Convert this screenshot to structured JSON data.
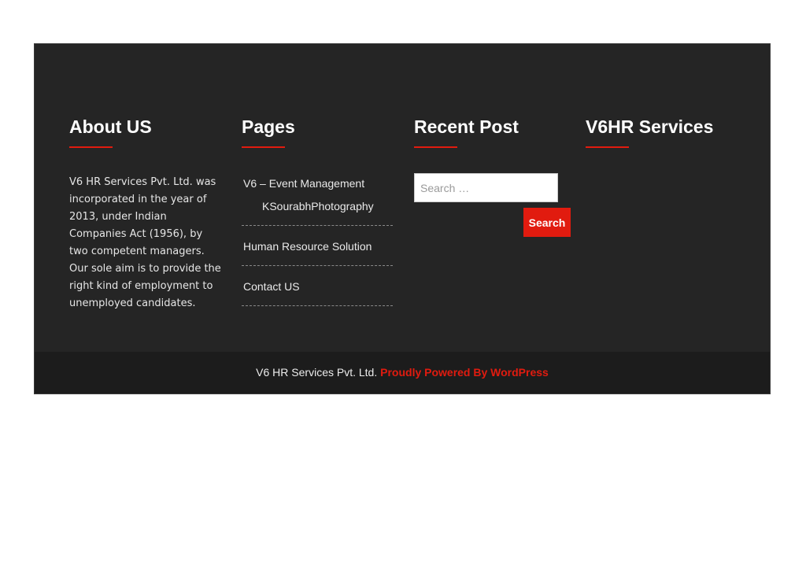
{
  "colors": {
    "footer_bg": "#252525",
    "copyright_bg": "#1c1c1c",
    "accent": "#e11b0f",
    "text": "#ececec"
  },
  "about": {
    "title": "About US",
    "text": "V6 HR Services Pvt. Ltd. was incorporated in the year of 2013, under Indian Companies Act (1956), by two competent managers. Our sole aim is to provide the right kind of employment to unemployed candidates."
  },
  "pages": {
    "title": "Pages",
    "items": [
      {
        "label": "V6 – Event Management",
        "sub": "KSourabhPhotography"
      },
      {
        "label": "Human Resource Solution"
      },
      {
        "label": "Contact US"
      }
    ]
  },
  "recent_post": {
    "title": "Recent Post",
    "search_placeholder": "Search …",
    "search_button": "Search"
  },
  "services": {
    "title": "V6HR Services"
  },
  "copyright": {
    "company": "V6 HR Services Pvt. Ltd.",
    "powered_by": "Proudly Powered By WordPress"
  }
}
